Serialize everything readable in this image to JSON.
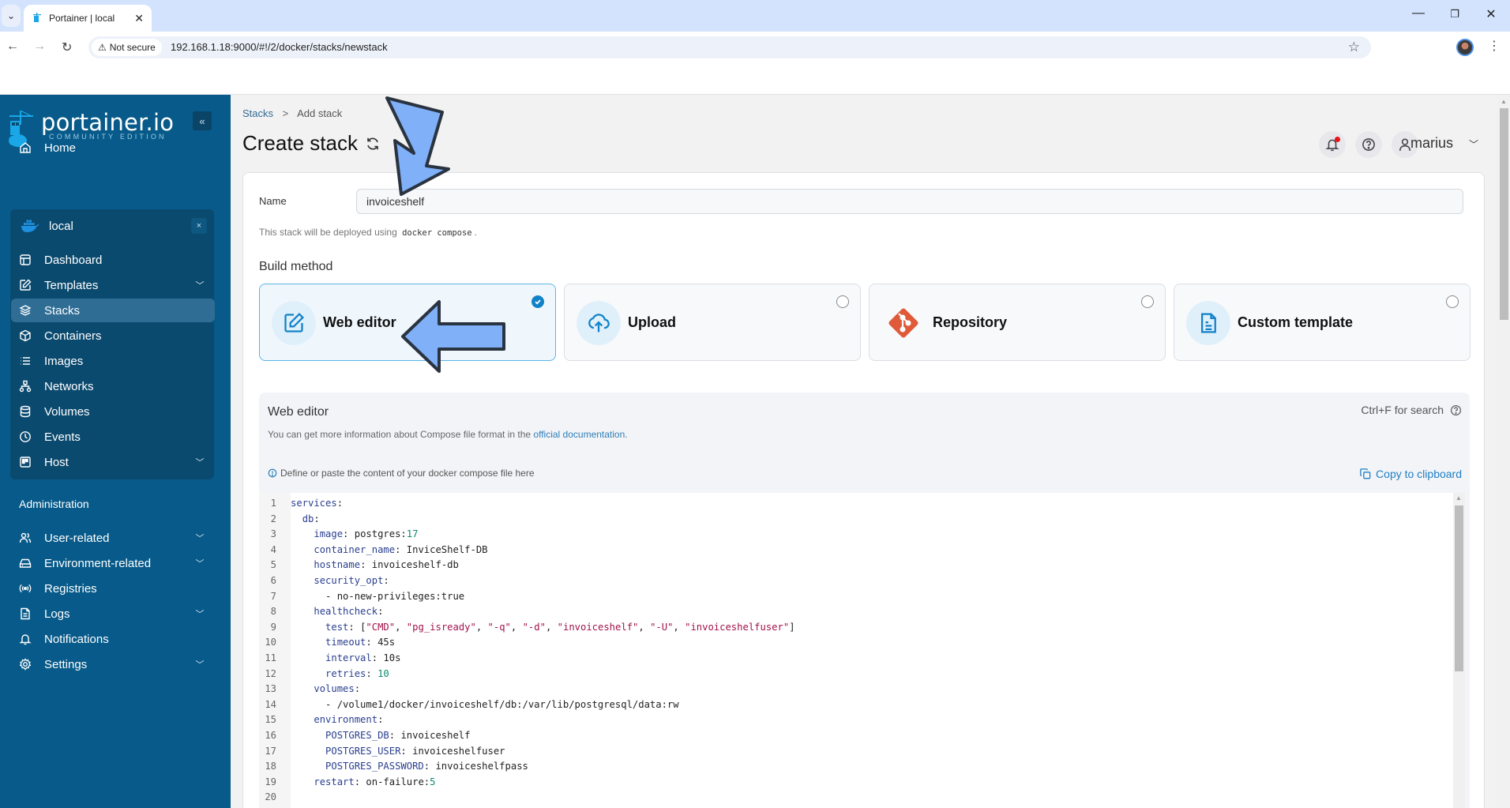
{
  "browser": {
    "tab_title": "Portainer | local",
    "security_label": "Not secure",
    "url": "192.168.1.18:9000/#!/2/docker/stacks/newstack"
  },
  "sidebar": {
    "logo_main": "portainer.io",
    "logo_sub": "COMMUNITY EDITION",
    "collapse_label": "«",
    "home": "Home",
    "environment": {
      "name": "local",
      "close_label": "×",
      "items": [
        {
          "label": "Dashboard",
          "icon": "dashboard-icon"
        },
        {
          "label": "Templates",
          "icon": "edit-icon",
          "expandable": true
        },
        {
          "label": "Stacks",
          "icon": "layers-icon",
          "active": true
        },
        {
          "label": "Containers",
          "icon": "box-icon"
        },
        {
          "label": "Images",
          "icon": "list-icon"
        },
        {
          "label": "Networks",
          "icon": "network-icon"
        },
        {
          "label": "Volumes",
          "icon": "database-icon"
        },
        {
          "label": "Events",
          "icon": "clock-icon"
        },
        {
          "label": "Host",
          "icon": "host-icon",
          "expandable": true
        }
      ]
    },
    "admin_title": "Administration",
    "admin_items": [
      {
        "label": "User-related",
        "icon": "users-icon",
        "expandable": true
      },
      {
        "label": "Environment-related",
        "icon": "drive-icon",
        "expandable": true
      },
      {
        "label": "Registries",
        "icon": "radio-icon"
      },
      {
        "label": "Logs",
        "icon": "file-icon",
        "expandable": true
      },
      {
        "label": "Notifications",
        "icon": "bell-icon"
      },
      {
        "label": "Settings",
        "icon": "gear-icon",
        "expandable": true
      }
    ]
  },
  "header": {
    "breadcrumb": {
      "parent": "Stacks",
      "separator": ">",
      "current": "Add stack"
    },
    "title": "Create stack",
    "username": "marius",
    "notification_dot_color": "#e8131b"
  },
  "form": {
    "name_label": "Name",
    "name_value": "invoiceshelf",
    "deploy_note_prefix": "This stack will be deployed using",
    "deploy_note_code": "docker compose",
    "deploy_note_suffix": ".",
    "build_method_title": "Build method",
    "methods": [
      {
        "label": "Web editor",
        "icon": "edit-icon",
        "selected": true
      },
      {
        "label": "Upload",
        "icon": "cloud-upload-icon",
        "selected": false
      },
      {
        "label": "Repository",
        "icon": "git-icon",
        "selected": false
      },
      {
        "label": "Custom template",
        "icon": "file-text-icon",
        "selected": false
      }
    ]
  },
  "editor": {
    "title": "Web editor",
    "search_hint": "Ctrl+F for search",
    "info_prefix": "You can get more information about Compose file format in the",
    "info_link": "official documentation",
    "info_suffix": ".",
    "hint": "Define or paste the content of your docker compose file here",
    "copy_label": "Copy to clipboard",
    "lines": [
      "services:",
      "  db:",
      "    image: postgres:17",
      "    container_name: InviceShelf-DB",
      "    hostname: invoiceshelf-db",
      "    security_opt:",
      "      - no-new-privileges:true",
      "    healthcheck:",
      "      test: [\"CMD\", \"pg_isready\", \"-q\", \"-d\", \"invoiceshelf\", \"-U\", \"invoiceshelfuser\"]",
      "      timeout: 45s",
      "      interval: 10s",
      "      retries: 10",
      "    volumes:",
      "      - /volume1/docker/invoiceshelf/db:/var/lib/postgresql/data:rw",
      "    environment:",
      "      POSTGRES_DB: invoiceshelf",
      "      POSTGRES_USER: invoiceshelfuser",
      "      POSTGRES_PASSWORD: invoiceshelfpass",
      "    restart: on-failure:5",
      ""
    ]
  },
  "colors": {
    "sidebar_bg": "#075a89",
    "accent": "#1182c8",
    "annotation_arrow": "#7fb0f8"
  }
}
